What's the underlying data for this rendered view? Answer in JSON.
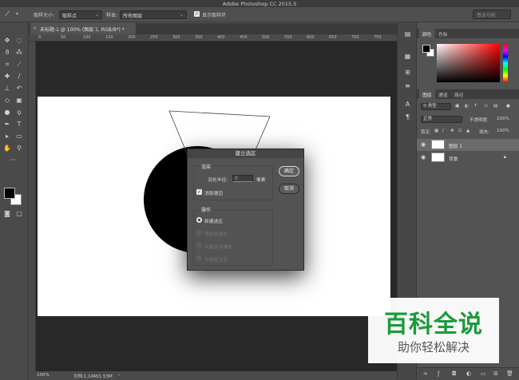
{
  "app": {
    "title": "Adobe Photoshop CC 2015.5"
  },
  "options_bar": {
    "sample_size_label": "取样大小:",
    "sample_size_value": "取样点",
    "sample_label": "样本:",
    "sample_value": "所有图层",
    "show_ring_label": "显示取样环",
    "search_placeholder": "基本功能"
  },
  "document_tab": {
    "label": "未标题-1 @ 100% (图层 1, RGB/8*) *"
  },
  "ruler": {
    "ticks": [
      "0",
      "50",
      "100",
      "150",
      "200",
      "250",
      "300",
      "350",
      "400",
      "450",
      "500",
      "550",
      "600",
      "650",
      "700",
      "750"
    ]
  },
  "status_bar": {
    "zoom": "100%",
    "doc_info": "文档:1.14M/1.53M"
  },
  "dialog": {
    "title": "建立选区",
    "render_group": "渲染",
    "feather_label": "羽化半径:",
    "feather_value": "0",
    "feather_unit": "像素",
    "antialias_label": "消除锯齿",
    "antialias_checked": true,
    "operation_group": "操作",
    "operations": [
      {
        "label": "新建选区",
        "selected": true,
        "enabled": true
      },
      {
        "label": "添加到选区",
        "selected": false,
        "enabled": false
      },
      {
        "label": "从选区中减去",
        "selected": false,
        "enabled": false
      },
      {
        "label": "与选区交叉",
        "selected": false,
        "enabled": false
      }
    ],
    "ok_label": "确定",
    "cancel_label": "取消"
  },
  "color_panel": {
    "tabs": [
      "颜色",
      "色板"
    ]
  },
  "layers_panel": {
    "tabs": [
      "图层",
      "通道",
      "路径"
    ],
    "filter_label": "类型",
    "blend_mode": "正常",
    "opacity_label": "不透明度:",
    "opacity_value": "100%",
    "lock_label": "锁定:",
    "fill_label": "填充:",
    "fill_value": "100%",
    "layers": [
      {
        "name": "图层 1",
        "selected": true
      },
      {
        "name": "背景",
        "selected": false,
        "locked": true
      }
    ]
  },
  "watermark": {
    "title": "百科全说",
    "subtitle": "助你轻松解决"
  },
  "colors": {
    "accent_green": "#1a9b3b",
    "panel_bg": "#535353",
    "canvas_bg": "#282828"
  }
}
